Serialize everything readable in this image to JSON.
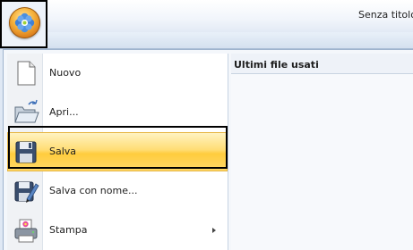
{
  "window": {
    "title": "Senza titolo"
  },
  "app_menu": {
    "items": [
      {
        "label": "Nuovo",
        "icon": "new-document-icon"
      },
      {
        "label": "Apri...",
        "icon": "open-folder-icon"
      },
      {
        "label": "Salva",
        "icon": "save-disk-icon",
        "state": "highlighted"
      },
      {
        "label": "Salva con nome...",
        "icon": "save-as-icon"
      },
      {
        "label": "Stampa",
        "icon": "printer-icon",
        "has_submenu": true
      }
    ],
    "recent": {
      "header": "Ultimi file usati"
    }
  },
  "colors": {
    "highlight": "#ffd45a",
    "accent": "#f6b23a"
  }
}
